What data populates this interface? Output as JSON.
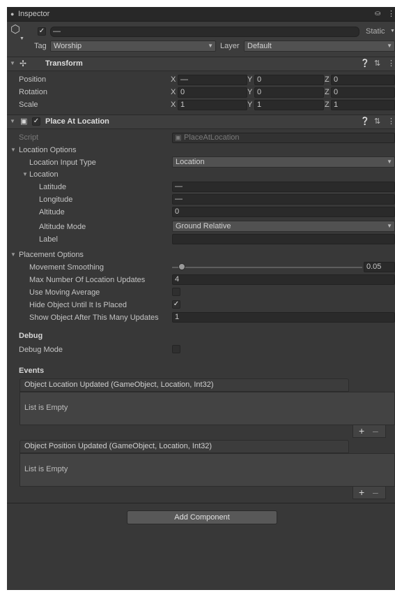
{
  "tab": {
    "title": "Inspector",
    "lock_icon": "lock-icon",
    "menu_icon": "kebab-menu-icon"
  },
  "object": {
    "name": "—",
    "static_label": "Static",
    "tag_label": "Tag",
    "tag_value": "Worship",
    "layer_label": "Layer",
    "layer_value": "Default"
  },
  "transform": {
    "title": "Transform",
    "position_label": "Position",
    "rotation_label": "Rotation",
    "scale_label": "Scale",
    "position": {
      "x": "—",
      "y": "0",
      "z": "0"
    },
    "rotation": {
      "x": "0",
      "y": "0",
      "z": "0"
    },
    "scale": {
      "x": "1",
      "y": "1",
      "z": "1"
    },
    "axis_x": "X",
    "axis_y": "Y",
    "axis_z": "Z"
  },
  "component": {
    "title": "Place At Location",
    "script_label": "Script",
    "script_value": "PlaceAtLocation",
    "location_options": "Location Options",
    "location_input_type_label": "Location Input Type",
    "location_input_type_value": "Location",
    "location_label": "Location",
    "latitude_label": "Latitude",
    "latitude_value": "—",
    "longitude_label": "Longitude",
    "longitude_value": "—",
    "altitude_label": "Altitude",
    "altitude_value": "0",
    "altitude_mode_label": "Altitude Mode",
    "altitude_mode_value": "Ground Relative",
    "label_label": "Label",
    "label_value": "",
    "placement_options": "Placement Options",
    "movement_smoothing_label": "Movement Smoothing",
    "movement_smoothing_value": "0.05",
    "movement_smoothing_fraction": 0.05,
    "max_updates_label": "Max Number Of Location Updates",
    "max_updates_value": "4",
    "use_moving_average_label": "Use Moving Average",
    "use_moving_average": false,
    "hide_object_label": "Hide Object Until It Is Placed",
    "hide_object": true,
    "show_after_label": "Show Object After This Many Updates",
    "show_after_value": "1",
    "debug_header": "Debug",
    "debug_mode_label": "Debug Mode",
    "debug_mode": false,
    "events_header": "Events",
    "event1_title": "Object Location Updated (GameObject, Location, Int32)",
    "event1_empty": "List is Empty",
    "event2_title": "Object Position Updated (GameObject, Location, Int32)",
    "event2_empty": "List is Empty",
    "plus": "+",
    "minus": "–"
  },
  "add_component": "Add Component"
}
